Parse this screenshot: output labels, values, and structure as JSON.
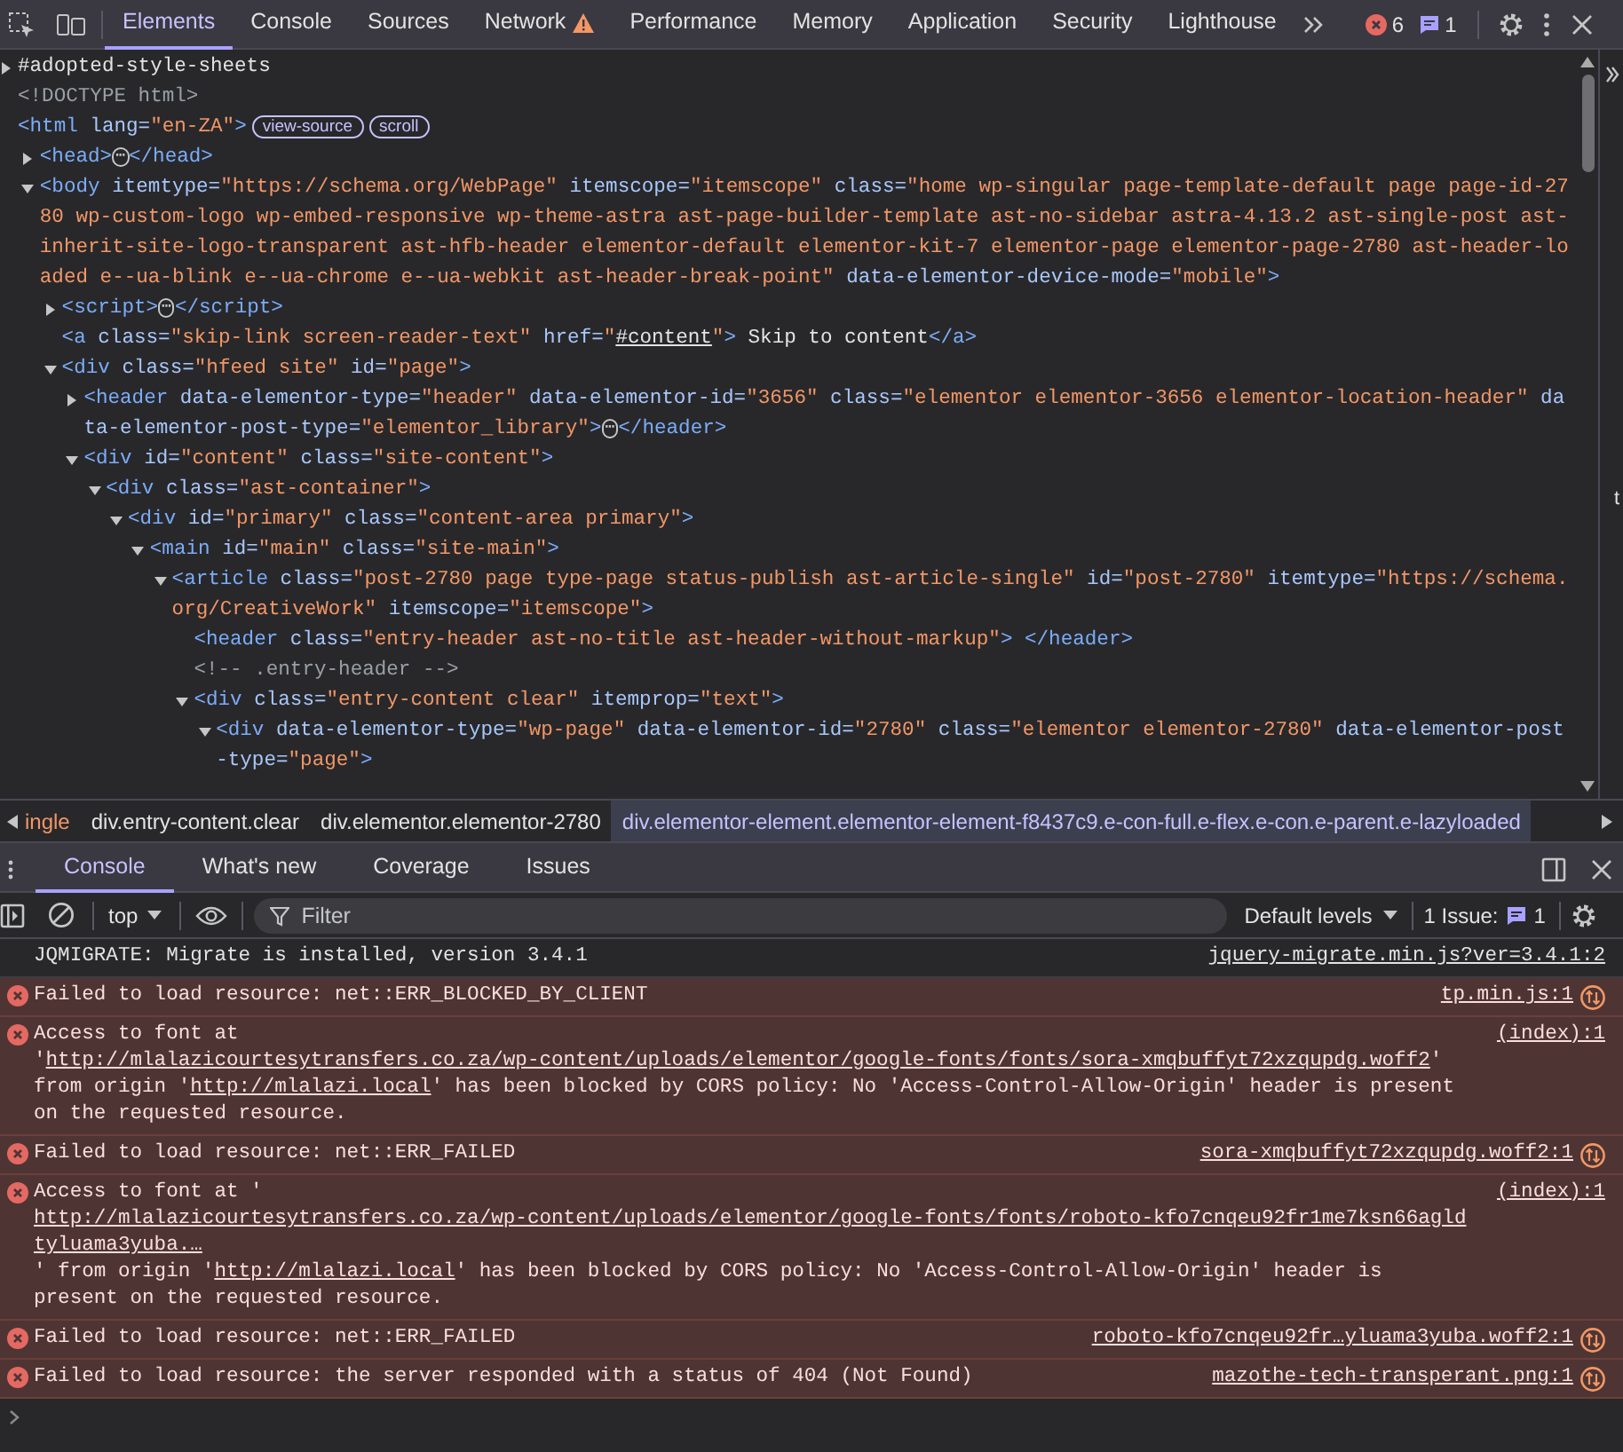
{
  "toolbar": {
    "tabs": [
      {
        "label": "Elements",
        "selected": true,
        "warning": false
      },
      {
        "label": "Console",
        "selected": false,
        "warning": false
      },
      {
        "label": "Sources",
        "selected": false,
        "warning": false
      },
      {
        "label": "Network",
        "selected": false,
        "warning": true
      },
      {
        "label": "Performance",
        "selected": false,
        "warning": false
      },
      {
        "label": "Memory",
        "selected": false,
        "warning": false
      },
      {
        "label": "Application",
        "selected": false,
        "warning": false
      },
      {
        "label": "Security",
        "selected": false,
        "warning": false
      },
      {
        "label": "Lighthouse",
        "selected": false,
        "warning": false
      }
    ],
    "error_count": "6",
    "message_count": "1"
  },
  "dom": [
    {
      "tokens": [
        {
          "kind": "text",
          "text": "#adopted-style-sheets"
        }
      ],
      "expanded": false
    },
    {
      "tokens": [
        {
          "kind": "comment",
          "text": "<!DOCTYPE html>"
        }
      ]
    },
    {
      "tokens": [
        {
          "kind": "tag",
          "text": "<html"
        },
        {
          "kind": "attr",
          "text": " lang="
        },
        {
          "kind": "value",
          "text": "\"en-ZA\""
        },
        {
          "kind": "tag",
          "text": ">"
        },
        {
          "kind": "badge",
          "text": "view-source"
        },
        {
          "kind": "badge",
          "text": "scroll"
        }
      ],
      "children": [
        {
          "tokens": [
            {
              "kind": "tag",
              "text": "<head>"
            },
            {
              "kind": "ellipsis",
              "text": "⋯"
            },
            {
              "kind": "tag",
              "text": "</head>"
            }
          ],
          "expanded": false
        },
        {
          "tokens": [
            {
              "kind": "tag",
              "text": "<body"
            },
            {
              "kind": "attr",
              "text": " itemtype="
            },
            {
              "kind": "value",
              "text": "\"https://schema.org/WebPage\""
            },
            {
              "kind": "attr",
              "text": " itemscope="
            },
            {
              "kind": "value",
              "text": "\"itemscope\""
            },
            {
              "kind": "attr",
              "text": " class="
            },
            {
              "kind": "value",
              "text": "\"home wp-singular page-template-default page page-id-2780 wp-custom-logo wp-embed-responsive wp-theme-astra ast-page-builder-template ast-no-sidebar astra-4.13.2 ast-single-post ast-inherit-site-logo-transparent ast-hfb-header elementor-default elementor-kit-7 elementor-page elementor-page-2780 ast-header-loaded e--ua-blink e--ua-chrome e--ua-webkit ast-header-break-point\""
            },
            {
              "kind": "attr",
              "text": " data-elementor-device-mode="
            },
            {
              "kind": "value",
              "text": "\"mobile\""
            },
            {
              "kind": "tag",
              "text": ">"
            }
          ],
          "expanded": true,
          "children": [
            {
              "tokens": [
                {
                  "kind": "tag",
                  "text": "<script>"
                },
                {
                  "kind": "ellipsis",
                  "text": "⋯"
                },
                {
                  "kind": "tag",
                  "text": "</script>"
                }
              ],
              "expanded": false
            },
            {
              "tokens": [
                {
                  "kind": "tag",
                  "text": "<a"
                },
                {
                  "kind": "attr",
                  "text": " class="
                },
                {
                  "kind": "value",
                  "text": "\"skip-link screen-reader-text\""
                },
                {
                  "kind": "attr",
                  "text": " href="
                },
                {
                  "kind": "value",
                  "text": "\""
                },
                {
                  "kind": "link",
                  "text": "#content"
                },
                {
                  "kind": "value",
                  "text": "\""
                },
                {
                  "kind": "tag",
                  "text": ">"
                },
                {
                  "kind": "text",
                  "text": " Skip to content"
                },
                {
                  "kind": "tag",
                  "text": "</a>"
                }
              ]
            },
            {
              "tokens": [
                {
                  "kind": "tag",
                  "text": "<div"
                },
                {
                  "kind": "attr",
                  "text": " class="
                },
                {
                  "kind": "value",
                  "text": "\"hfeed site\""
                },
                {
                  "kind": "attr",
                  "text": " id="
                },
                {
                  "kind": "value",
                  "text": "\"page\""
                },
                {
                  "kind": "tag",
                  "text": ">"
                }
              ],
              "expanded": true,
              "children": [
                {
                  "tokens": [
                    {
                      "kind": "tag",
                      "text": "<header"
                    },
                    {
                      "kind": "attr",
                      "text": " data-elementor-type="
                    },
                    {
                      "kind": "value",
                      "text": "\"header\""
                    },
                    {
                      "kind": "attr",
                      "text": " data-elementor-id="
                    },
                    {
                      "kind": "value",
                      "text": "\"3656\""
                    },
                    {
                      "kind": "attr",
                      "text": " class="
                    },
                    {
                      "kind": "value",
                      "text": "\"elementor elementor-3656 elementor-location-header\""
                    },
                    {
                      "kind": "attr",
                      "text": " data-elementor-post-type="
                    },
                    {
                      "kind": "value",
                      "text": "\"elementor_library\""
                    },
                    {
                      "kind": "tag",
                      "text": ">"
                    },
                    {
                      "kind": "ellipsis",
                      "text": "⋯"
                    },
                    {
                      "kind": "tag",
                      "text": "</header>"
                    }
                  ],
                  "expanded": false
                },
                {
                  "tokens": [
                    {
                      "kind": "tag",
                      "text": "<div"
                    },
                    {
                      "kind": "attr",
                      "text": " id="
                    },
                    {
                      "kind": "value",
                      "text": "\"content\""
                    },
                    {
                      "kind": "attr",
                      "text": " class="
                    },
                    {
                      "kind": "value",
                      "text": "\"site-content\""
                    },
                    {
                      "kind": "tag",
                      "text": ">"
                    }
                  ],
                  "expanded": true,
                  "children": [
                    {
                      "tokens": [
                        {
                          "kind": "tag",
                          "text": "<div"
                        },
                        {
                          "kind": "attr",
                          "text": " class="
                        },
                        {
                          "kind": "value",
                          "text": "\"ast-container\""
                        },
                        {
                          "kind": "tag",
                          "text": ">"
                        }
                      ],
                      "expanded": true,
                      "children": [
                        {
                          "tokens": [
                            {
                              "kind": "tag",
                              "text": "<div"
                            },
                            {
                              "kind": "attr",
                              "text": " id="
                            },
                            {
                              "kind": "value",
                              "text": "\"primary\""
                            },
                            {
                              "kind": "attr",
                              "text": " class="
                            },
                            {
                              "kind": "value",
                              "text": "\"content-area primary\""
                            },
                            {
                              "kind": "tag",
                              "text": ">"
                            }
                          ],
                          "expanded": true,
                          "children": [
                            {
                              "tokens": [
                                {
                                  "kind": "tag",
                                  "text": "<main"
                                },
                                {
                                  "kind": "attr",
                                  "text": " id="
                                },
                                {
                                  "kind": "value",
                                  "text": "\"main\""
                                },
                                {
                                  "kind": "attr",
                                  "text": " class="
                                },
                                {
                                  "kind": "value",
                                  "text": "\"site-main\""
                                },
                                {
                                  "kind": "tag",
                                  "text": ">"
                                }
                              ],
                              "expanded": true,
                              "children": [
                                {
                                  "tokens": [
                                    {
                                      "kind": "tag",
                                      "text": "<article"
                                    },
                                    {
                                      "kind": "attr",
                                      "text": " class="
                                    },
                                    {
                                      "kind": "value",
                                      "text": "\"post-2780 page type-page status-publish ast-article-single\""
                                    },
                                    {
                                      "kind": "attr",
                                      "text": " id="
                                    },
                                    {
                                      "kind": "value",
                                      "text": "\"post-2780\""
                                    },
                                    {
                                      "kind": "attr",
                                      "text": " itemtype="
                                    },
                                    {
                                      "kind": "value",
                                      "text": "\"https://schema.org/CreativeWork\""
                                    },
                                    {
                                      "kind": "attr",
                                      "text": " itemscope="
                                    },
                                    {
                                      "kind": "value",
                                      "text": "\"itemscope\""
                                    },
                                    {
                                      "kind": "tag",
                                      "text": ">"
                                    }
                                  ],
                                  "expanded": true,
                                  "children": [
                                    {
                                      "tokens": [
                                        {
                                          "kind": "tag",
                                          "text": "<header"
                                        },
                                        {
                                          "kind": "attr",
                                          "text": " class="
                                        },
                                        {
                                          "kind": "value",
                                          "text": "\"entry-header ast-no-title ast-header-without-markup\""
                                        },
                                        {
                                          "kind": "tag",
                                          "text": ">"
                                        },
                                        {
                                          "kind": "tag",
                                          "text": " </header>"
                                        }
                                      ]
                                    },
                                    {
                                      "tokens": [
                                        {
                                          "kind": "comment",
                                          "text": "<!-- .entry-header -->"
                                        }
                                      ]
                                    },
                                    {
                                      "tokens": [
                                        {
                                          "kind": "tag",
                                          "text": "<div"
                                        },
                                        {
                                          "kind": "attr",
                                          "text": " class="
                                        },
                                        {
                                          "kind": "value",
                                          "text": "\"entry-content clear\""
                                        },
                                        {
                                          "kind": "attr",
                                          "text": " itemprop="
                                        },
                                        {
                                          "kind": "value",
                                          "text": "\"text\""
                                        },
                                        {
                                          "kind": "tag",
                                          "text": ">"
                                        }
                                      ],
                                      "expanded": true,
                                      "children": [
                                        {
                                          "tokens": [
                                            {
                                              "kind": "tag",
                                              "text": "<div"
                                            },
                                            {
                                              "kind": "attr",
                                              "text": " data-elementor-type="
                                            },
                                            {
                                              "kind": "value",
                                              "text": "\"wp-page\""
                                            },
                                            {
                                              "kind": "attr",
                                              "text": " data-elementor-id="
                                            },
                                            {
                                              "kind": "value",
                                              "text": "\"2780\""
                                            },
                                            {
                                              "kind": "attr",
                                              "text": " class="
                                            },
                                            {
                                              "kind": "value",
                                              "text": "\"elementor elementor-2780\""
                                            },
                                            {
                                              "kind": "attr",
                                              "text": " data-elementor-post-type="
                                            },
                                            {
                                              "kind": "value",
                                              "text": "\"page\""
                                            },
                                            {
                                              "kind": "tag",
                                              "text": ">"
                                            }
                                          ],
                                          "expanded": true
                                        }
                                      ]
                                    }
                                  ]
                                }
                              ]
                            }
                          ]
                        }
                      ]
                    }
                  ]
                }
              ]
            }
          ]
        }
      ]
    }
  ],
  "breadcrumbs": [
    {
      "label": "ingle",
      "selected": false
    },
    {
      "label": "div.entry-content.clear",
      "selected": false
    },
    {
      "label": "div.elementor.elementor-2780",
      "selected": false
    },
    {
      "label": "div.elementor-element.elementor-element-f8437c9.e-con-full.e-flex.e-con.e-parent.e-lazyloaded",
      "selected": true
    }
  ],
  "side_panel": {
    "fragment": "t"
  },
  "drawer": {
    "tabs": [
      {
        "label": "Console",
        "selected": true
      },
      {
        "label": "What's new",
        "selected": false
      },
      {
        "label": "Coverage",
        "selected": false
      },
      {
        "label": "Issues",
        "selected": false
      }
    ]
  },
  "console_toolbar": {
    "context": "top",
    "filter": {
      "placeholder": "Filter"
    },
    "levels": "Default levels",
    "issues_label": "1 Issue:",
    "issues_count": "1"
  },
  "messages": [
    {
      "kind": "info",
      "parts": [
        {
          "kind": "text",
          "text": "JQMIGRATE: Migrate is installed, version 3.4.1"
        }
      ],
      "source": "jquery-migrate.min.js?ver=3.4.1:2",
      "network": false
    },
    {
      "kind": "error",
      "parts": [
        {
          "kind": "text",
          "text": "Failed to load resource: net::ERR_BLOCKED_BY_CLIENT"
        }
      ],
      "source": "tp.min.js:1",
      "network": true
    },
    {
      "kind": "error",
      "parts": [
        {
          "kind": "text",
          "text": "Access to font at '"
        },
        {
          "kind": "link",
          "text": "http://mlalazicourtesytransfers.co.za/wp-content/uploads/elementor/google-fonts/fonts/sora-xmqbuffyt72xzqupdg.woff2"
        },
        {
          "kind": "text",
          "text": "' from origin '"
        },
        {
          "kind": "link",
          "text": "http://mlalazi.local"
        },
        {
          "kind": "text",
          "text": "' has been blocked by CORS policy: No 'Access-Control-Allow-Origin' header is present on the requested resource."
        }
      ],
      "source": "(index):1",
      "network": false
    },
    {
      "kind": "error",
      "parts": [
        {
          "kind": "text",
          "text": "Failed to load resource: net::ERR_FAILED"
        }
      ],
      "source": "sora-xmqbuffyt72xzqupdg.woff2:1",
      "network": true
    },
    {
      "kind": "error",
      "parts": [
        {
          "kind": "text",
          "text": "Access to font at '"
        },
        {
          "kind": "link_line",
          "text": "http://mlalazicourtesytransfers.co.za/wp-content/uploads/elementor/google-fonts/fonts/roboto-kfo7cnqeu92fr1me7ksn66agldtyluama3yuba.…"
        },
        {
          "kind": "text",
          "text": "' from origin '"
        },
        {
          "kind": "link",
          "text": "http://mlalazi.local"
        },
        {
          "kind": "text",
          "text": "' has been blocked by CORS policy: No 'Access-Control-Allow-Origin' header is present on the requested resource."
        }
      ],
      "source": "(index):1",
      "network": false
    },
    {
      "kind": "error",
      "parts": [
        {
          "kind": "text",
          "text": "Failed to load resource: net::ERR_FAILED"
        }
      ],
      "source": "roboto-kfo7cnqeu92fr…yluama3yuba.woff2:1",
      "network": true
    },
    {
      "kind": "error",
      "parts": [
        {
          "kind": "text",
          "text": "Failed to load resource: the server responded with a status of 404 (Not Found)"
        }
      ],
      "source": "mazothe-tech-transperant.png:1",
      "network": true
    }
  ]
}
